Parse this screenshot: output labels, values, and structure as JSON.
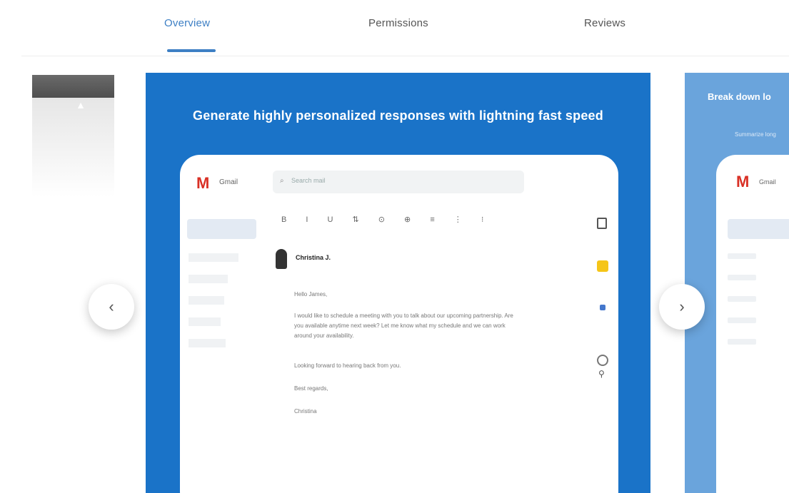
{
  "tabs": [
    {
      "label": "Overview",
      "active": true
    },
    {
      "label": "Permissions",
      "active": false
    },
    {
      "label": "Reviews",
      "active": false
    }
  ],
  "slide": {
    "title": "Generate highly personalized responses with lightning fast speed",
    "mock": {
      "logo_word": "Gmail",
      "search_placeholder": "Search mail",
      "sender": "Christina J.",
      "greeting": "Hello James,",
      "body_1": "I would like to schedule a meeting with you to talk about our upcoming partnership. Are",
      "body_2": "you available anytime next week? Let me know what my schedule and we can work",
      "body_3": "around your availability.",
      "closing_line": "Looking forward to hearing back from you.",
      "signoff": "Best regards,",
      "signature": "Christina"
    }
  },
  "right_peek": {
    "title": "Break down lo",
    "subtitle": "Summarize long"
  },
  "colors": {
    "accent": "#3d7fc4",
    "slide_bg": "#1a73c8",
    "peek_bg": "#6aa4dc"
  },
  "icons": {
    "prev": "chevron-left-icon",
    "next": "chevron-right-icon"
  }
}
